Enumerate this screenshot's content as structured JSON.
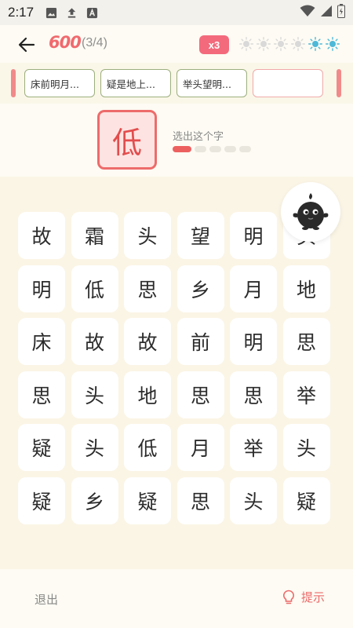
{
  "status_bar": {
    "time": "2:17",
    "left_icons": [
      "image-icon",
      "upload-icon",
      "app-a-icon"
    ],
    "right_icons": [
      "wifi-icon",
      "signal-icon",
      "battery-icon"
    ]
  },
  "header": {
    "score": "600",
    "progress": "(3/4)",
    "multiplier": "x3",
    "suns": [
      {
        "state": "inactive"
      },
      {
        "state": "inactive"
      },
      {
        "state": "inactive"
      },
      {
        "state": "inactive"
      },
      {
        "state": "active"
      },
      {
        "state": "active"
      }
    ]
  },
  "verses": [
    {
      "text": "床前明月..."
    },
    {
      "text": "疑是地上..."
    },
    {
      "text": "举头望明..."
    },
    {
      "text": ""
    }
  ],
  "target": {
    "char": "低",
    "instruction": "选出这个字",
    "steps_total": 5,
    "steps_done": 1
  },
  "grid": {
    "rows": [
      [
        "故",
        "霜",
        "头",
        "望",
        "明",
        "头"
      ],
      [
        "明",
        "低",
        "思",
        "乡",
        "月",
        "地"
      ],
      [
        "床",
        "故",
        "故",
        "前",
        "明",
        "思"
      ],
      [
        "思",
        "头",
        "地",
        "思",
        "思",
        "举"
      ],
      [
        "疑",
        "头",
        "低",
        "月",
        "举",
        "头"
      ],
      [
        "疑",
        "乡",
        "疑",
        "思",
        "头",
        "疑"
      ]
    ]
  },
  "footer": {
    "exit_label": "退出",
    "hint_label": "提示"
  },
  "colors": {
    "accent": "#ed6b6b",
    "score": "#f06a6e",
    "sun_active": "#4db8d8",
    "sun_inactive": "#d9d9d9",
    "verse_border": "#9caf7d"
  }
}
